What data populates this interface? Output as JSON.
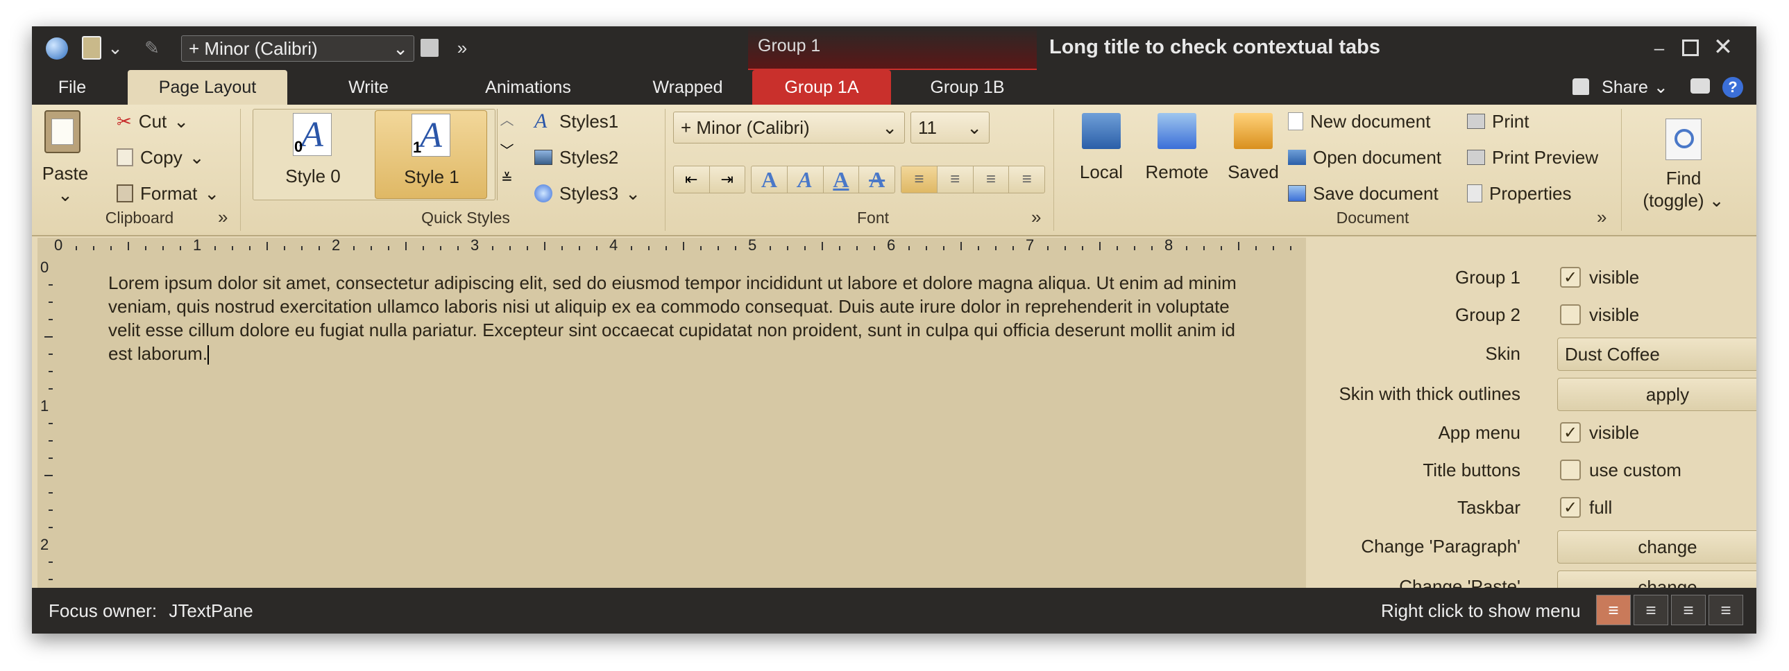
{
  "titlebar": {
    "font_combo": "+ Minor (Calibri)",
    "context_group": "Group 1",
    "title": "Long title to check contextual tabs"
  },
  "tabs": [
    {
      "label": "File"
    },
    {
      "label": "Page Layout"
    },
    {
      "label": "Write"
    },
    {
      "label": "Animations"
    },
    {
      "label": "Wrapped"
    },
    {
      "label": "Group 1A"
    },
    {
      "label": "Group 1B"
    }
  ],
  "share_label": "Share",
  "ribbon": {
    "clipboard": {
      "paste": "Paste",
      "cut": "Cut",
      "copy": "Copy",
      "format": "Format",
      "label": "Clipboard"
    },
    "quickstyles": {
      "style0": "Style 0",
      "style1": "Style 1",
      "badge0": "0",
      "badge1": "1",
      "styles": [
        "Styles1",
        "Styles2",
        "Styles3"
      ],
      "label": "Quick Styles"
    },
    "font": {
      "family": "+ Minor (Calibri)",
      "size": "11",
      "label": "Font"
    },
    "document": {
      "local": "Local",
      "remote": "Remote",
      "saved": "Saved",
      "new": "New document",
      "open": "Open document",
      "save": "Save document",
      "print": "Print",
      "preview": "Print Preview",
      "properties": "Properties",
      "label": "Document"
    },
    "find": {
      "line1": "Find",
      "line2": "(toggle)"
    }
  },
  "ruler": {
    "h": [
      "0",
      "1",
      "2",
      "3",
      "4",
      "5",
      "6",
      "7",
      "8"
    ],
    "v": [
      "0",
      "1",
      "2"
    ]
  },
  "editor_text": "Lorem ipsum dolor sit amet, consectetur adipiscing elit, sed do eiusmod tempor incididunt ut labore et dolore magna aliqua. Ut enim ad minim veniam, quis nostrud exercitation ullamco laboris nisi ut aliquip ex ea commodo consequat. Duis aute irure dolor in reprehenderit in voluptate velit esse cillum dolore eu fugiat nulla pariatur. Excepteur sint occaecat cupidatat non proident, sunt in culpa qui officia deserunt mollit anim id est laborum.",
  "side": {
    "group1": "Group 1",
    "group1_chk": "visible",
    "group2": "Group 2",
    "group2_chk": "visible",
    "skin": "Skin",
    "skin_value": "Dust Coffee",
    "thick": "Skin with thick outlines",
    "apply": "apply",
    "appmenu": "App menu",
    "appmenu_chk": "visible",
    "titlebtn": "Title buttons",
    "titlebtn_chk": "use custom",
    "taskbar": "Taskbar",
    "taskbar_chk": "full",
    "para": "Change 'Paragraph'",
    "change": "change",
    "paste": "Change 'Paste'",
    "change2": "change"
  },
  "status": {
    "focus_label": "Focus owner:",
    "focus_value": "JTextPane",
    "hint": "Right click to show menu"
  },
  "colors": {
    "ribbon": "#e6d9b8",
    "dark": "#2b2927",
    "context": "#c9302c"
  }
}
